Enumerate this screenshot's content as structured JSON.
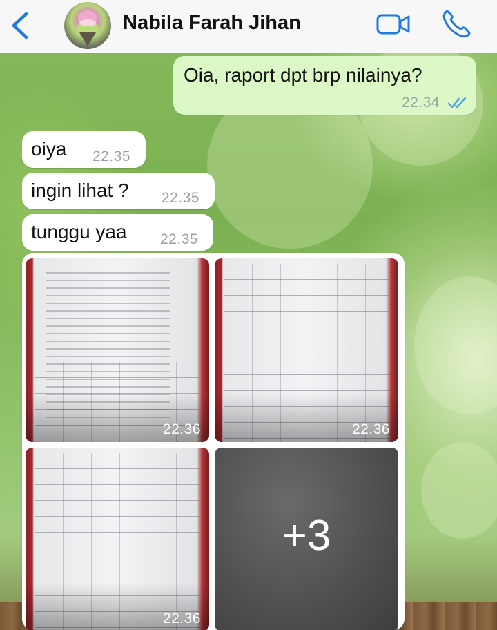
{
  "header": {
    "contact_name": "Nabila Farah Jihan",
    "back_icon": "chevron-left-icon",
    "video_icon": "video-camera-icon",
    "phone_icon": "phone-icon",
    "accent_color": "#1f7ae0"
  },
  "messages": [
    {
      "direction": "outgoing",
      "text": "Oia, raport dpt brp nilainya?",
      "time": "22.34",
      "status": "read"
    },
    {
      "direction": "incoming",
      "text": "oiya",
      "time": "22.35"
    },
    {
      "direction": "incoming",
      "text": "ingin lihat ?",
      "time": "22.35"
    },
    {
      "direction": "incoming",
      "text": "tunggu yaa",
      "time": "22.35"
    }
  ],
  "media_group": {
    "tiles": [
      {
        "type": "photo",
        "time": "22.36"
      },
      {
        "type": "photo",
        "time": "22.36"
      },
      {
        "type": "photo",
        "time": "22.36"
      },
      {
        "type": "more",
        "label": "+3"
      }
    ]
  },
  "colors": {
    "outgoing_bubble": "#dcf8c6",
    "incoming_bubble": "#ffffff",
    "read_tick": "#4fa3e8"
  }
}
